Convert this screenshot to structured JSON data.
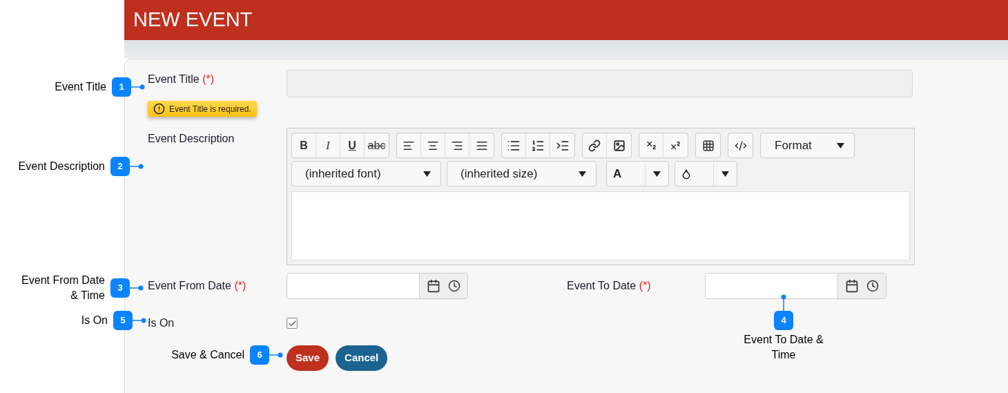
{
  "header": {
    "title": "NEW EVENT"
  },
  "event_title": {
    "label": "Event Title",
    "required_mark": "(*)",
    "validation": "Event Title is required."
  },
  "event_description": {
    "label": "Event Description",
    "format_buttons": [
      "B",
      "I",
      "U",
      "abc"
    ],
    "format_dropdown": "Format",
    "font_select": "(inherited font)",
    "size_select": "(inherited size)",
    "text_color_glyph": "A"
  },
  "from_date": {
    "label": "Event From Date",
    "required_mark": "(*)"
  },
  "to_date": {
    "label": "Event To Date",
    "required_mark": "(*)"
  },
  "is_on": {
    "label": "Is On",
    "checked": true
  },
  "buttons": {
    "save": "Save",
    "cancel": "Cancel"
  },
  "annotations": [
    {
      "number": "1",
      "text": "Event Title"
    },
    {
      "number": "2",
      "text": "Event Description"
    },
    {
      "number": "3",
      "text": "Event From Date & Time"
    },
    {
      "number": "5",
      "text": "Is On"
    },
    {
      "number": "6",
      "text": "Save & Cancel"
    },
    {
      "number": "4",
      "text": "Event To Date & Time"
    }
  ]
}
